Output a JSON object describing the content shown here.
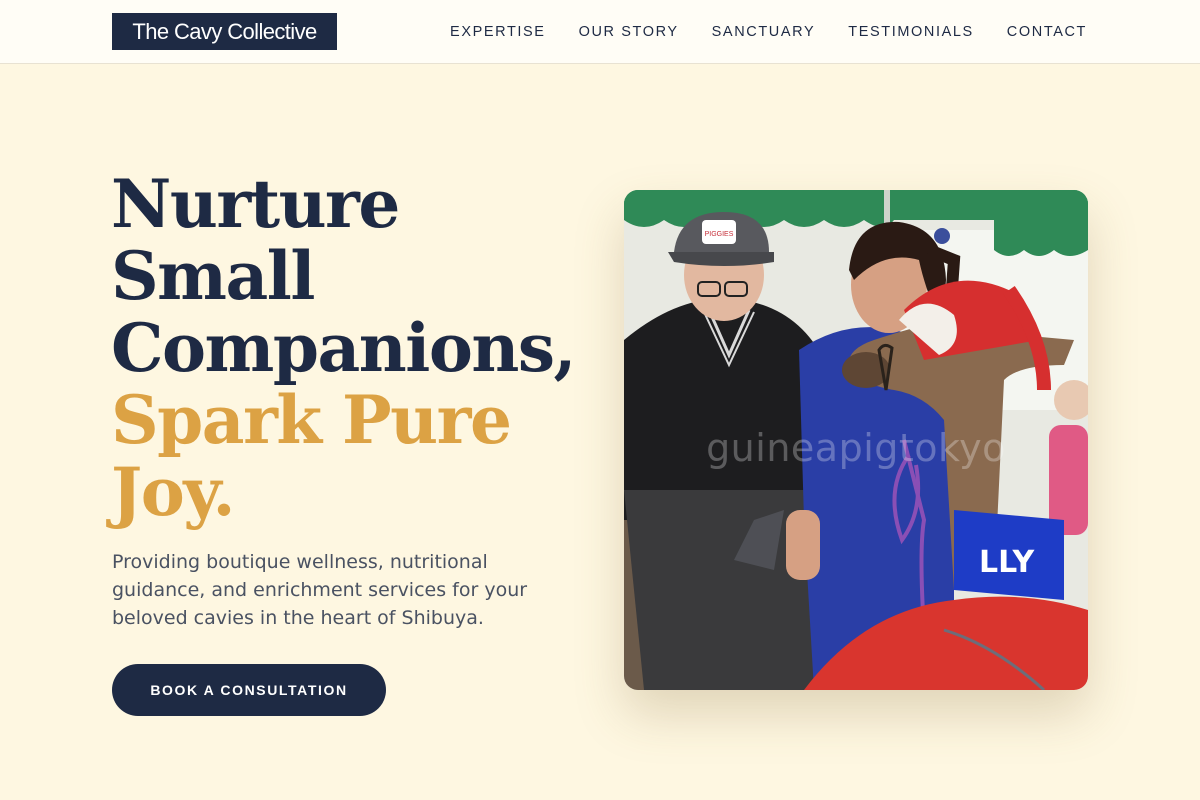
{
  "header": {
    "logo": "The Cavy Collective",
    "nav": [
      {
        "label": "EXPERTISE"
      },
      {
        "label": "OUR STORY"
      },
      {
        "label": "SANCTUARY"
      },
      {
        "label": "TESTIMONIALS"
      },
      {
        "label": "CONTACT"
      }
    ]
  },
  "hero": {
    "title_lines": [
      "Nurture",
      "Small",
      "Companions,"
    ],
    "title_accent_lines": [
      "Spark Pure",
      "Joy."
    ],
    "subtitle": "Providing boutique wellness, nutritional guidance, and enrichment services for your beloved cavies in the heart of Shibuya.",
    "cta_label": "BOOK A CONSULTATION",
    "photo": {
      "watermark": "guineapigtokyo",
      "cap_badge": "PIGGIES",
      "jersey_text": "LLY"
    }
  },
  "colors": {
    "navy": "#1e2a44",
    "gold": "#dca244",
    "cream": "#fef7e1",
    "text_gray": "#4a5262"
  }
}
